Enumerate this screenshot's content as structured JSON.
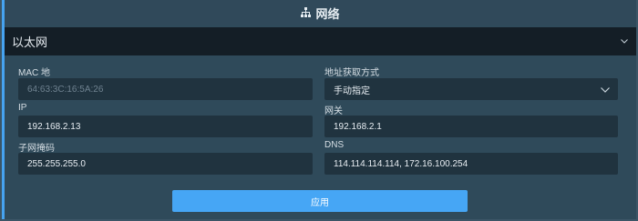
{
  "header": {
    "title": "网络",
    "icon": "network-icon"
  },
  "section": {
    "title": "以太网",
    "icon": "chevron-down-icon"
  },
  "form": {
    "mac": {
      "label": "MAC 地",
      "value": "64:63:3C:16:5A:26"
    },
    "ip_mode": {
      "label": "地址获取方式",
      "value": "手动指定"
    },
    "ip": {
      "label": "IP",
      "value": "192.168.2.13"
    },
    "gateway": {
      "label": "网关",
      "value": "192.168.2.1"
    },
    "netmask": {
      "label": "子网掩码",
      "value": "255.255.255.0"
    },
    "dns": {
      "label": "DNS",
      "value": "114.114.114.114, 172.16.100.254"
    }
  },
  "actions": {
    "apply_label": "应用"
  },
  "colors": {
    "accent": "#46a6f5",
    "background": "#2f4a5a",
    "section_bar": "#141e26",
    "input": "#20333f"
  }
}
